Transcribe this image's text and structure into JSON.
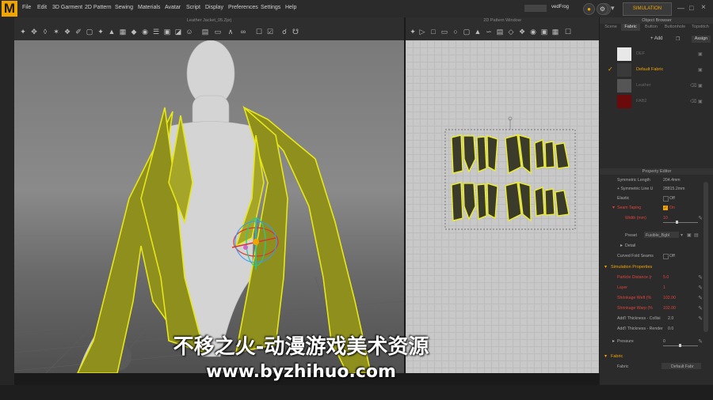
{
  "app": {
    "logo_letter": "M"
  },
  "menu": {
    "items": [
      "File",
      "Edit",
      "3D Garment",
      "2D Pattern",
      "Sewing",
      "Materials",
      "Avatar",
      "Script",
      "Display",
      "Preferences",
      "Settings",
      "Help"
    ]
  },
  "user": {
    "name": "vedFrog"
  },
  "simulation_button": "SIMULATION",
  "viewport": {
    "title": "Leather Jacket_05.Zprj"
  },
  "pattern_window": {
    "title": "2D Pattern Window"
  },
  "object_browser": {
    "title": "Object Browser",
    "tabs": [
      "Scene",
      "Fabric",
      "Button",
      "Buttonhole",
      "Topstitch"
    ],
    "active_tab": "Fabric",
    "add_label": "+ Add",
    "assign_label": "Assign",
    "fabrics": [
      {
        "label": "DEF",
        "color": "#e8e8e8",
        "selected": false
      },
      {
        "label": "Default Fabric",
        "color": "#3a3a3a",
        "selected": true
      },
      {
        "label": "Leather",
        "color": "#555555",
        "selected": false
      },
      {
        "label": "FAB2",
        "color": "#6b0a0a",
        "selected": false
      }
    ]
  },
  "property_editor": {
    "title": "Property Editor",
    "rows": {
      "symmetric_length_label": "Symmetric Length",
      "symmetric_length_value": "204.4mm",
      "symmetric_line_label": "+ Symmetric Line U",
      "symmetric_line_value": "28815.2mm",
      "elastic_label": "Elastic",
      "elastic_value": "Off",
      "seam_taping_label": "Seam Taping",
      "seam_taping_value": "On",
      "width_label": "Width (mm)",
      "width_value": "10",
      "preset_label": "Preset",
      "preset_value": "Fusible_Bgbl",
      "detail_label": "Detail",
      "curved_fold_label": "Curved Fold Seams",
      "curved_fold_value": "Off",
      "sim_props_label": "Simulation Properties",
      "particle_label": "Particle Distance (r",
      "particle_value": "5.0",
      "layer_label": "Layer",
      "layer_value": "1",
      "shrink_weft_label": "Shrinkage Weft (%",
      "shrink_weft_value": "102.00",
      "shrink_warp_label": "Shrinkage Warp (%",
      "shrink_warp_value": "102.00",
      "addl_collision_label": "Add'l Thickness - Collisi",
      "addl_collision_value": "2.0",
      "addl_render_label": "Add'l Thickness - Render",
      "addl_render_value": "0.0",
      "pressure_label": "Pressure",
      "pressure_value": "0",
      "fabric_section_label": "Fabric",
      "fabric_label": "Fabric",
      "fabric_value": "Default Fabr"
    }
  },
  "watermark": {
    "cn": "不移之火-动漫游戏美术资源",
    "url": "www.byzhihuo.com"
  }
}
